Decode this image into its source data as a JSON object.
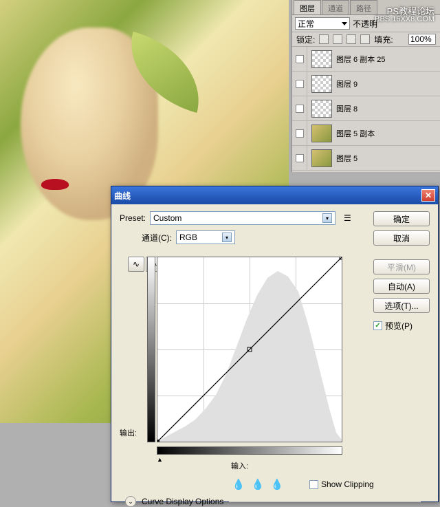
{
  "watermark": {
    "line1": "PS教程论坛",
    "line2": "BBS.16XX8.COM"
  },
  "layers_panel": {
    "tabs": [
      "图层",
      "通道",
      "路径"
    ],
    "blend_mode": "正常",
    "opacity_label": "不透明",
    "lock_label": "锁定:",
    "fill_label": "填充:",
    "fill_value": "100%",
    "layers": [
      {
        "name": "图层 6 副本 25",
        "thumb": "trans"
      },
      {
        "name": "图层 9",
        "thumb": "trans"
      },
      {
        "name": "图层 8",
        "thumb": "trans"
      },
      {
        "name": "图层 5 副本",
        "thumb": "img"
      },
      {
        "name": "图层 5",
        "thumb": "img"
      }
    ]
  },
  "dialog": {
    "title": "曲线",
    "preset_label": "Preset:",
    "preset_value": "Custom",
    "channel_label": "通道(C):",
    "channel_value": "RGB",
    "output_label": "输出:",
    "input_label": "输入:",
    "buttons": {
      "ok": "确定",
      "cancel": "取消",
      "smooth": "平滑(M)",
      "auto": "自动(A)",
      "options": "选项(T)..."
    },
    "preview_label": "预览(P)",
    "show_clipping": "Show Clipping",
    "display_options": "Curve Display Options"
  },
  "chart_data": {
    "type": "line",
    "title": "曲线",
    "xlabel": "输入",
    "ylabel": "输出",
    "xlim": [
      0,
      255
    ],
    "ylim": [
      0,
      255
    ],
    "series": [
      {
        "name": "RGB curve",
        "x": [
          0,
          127,
          255
        ],
        "y": [
          0,
          127,
          255
        ]
      }
    ],
    "histogram": {
      "x_bins": [
        0,
        16,
        32,
        48,
        64,
        80,
        96,
        112,
        128,
        144,
        160,
        176,
        192,
        208,
        224,
        240,
        255
      ],
      "heights_pct": [
        2,
        5,
        8,
        12,
        18,
        25,
        38,
        55,
        72,
        85,
        92,
        88,
        78,
        60,
        40,
        15,
        3
      ]
    },
    "grid": true
  }
}
